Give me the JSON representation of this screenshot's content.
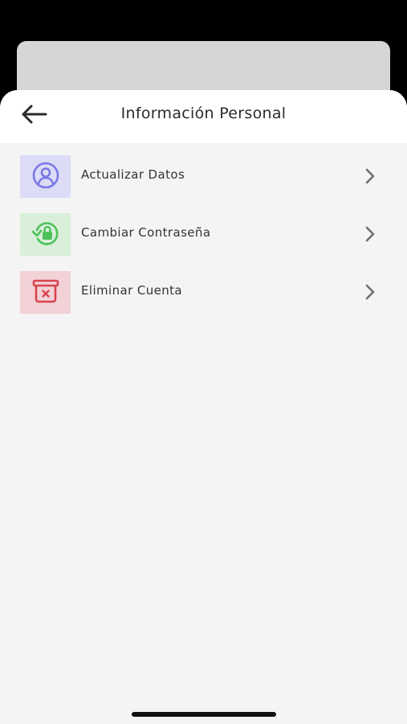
{
  "header": {
    "title": "Información Personal",
    "back_icon": "arrow-left-icon"
  },
  "menu": {
    "items": [
      {
        "label": "Actualizar Datos",
        "icon": "user-circle-icon",
        "tile_color": "#dcdcf6",
        "icon_color": "#7b78e6"
      },
      {
        "label": "Cambiar Contraseña",
        "icon": "lock-reset-icon",
        "tile_color": "#d9efd9",
        "icon_color": "#4cc25a"
      },
      {
        "label": "Eliminar Cuenta",
        "icon": "trash-icon",
        "tile_color": "#f2d2d6",
        "icon_color": "#d9434f"
      }
    ],
    "chevron_icon": "chevron-right-icon"
  },
  "colors": {
    "sheet_background": "#f4f4f4",
    "header_background": "#ffffff",
    "text": "#333333"
  }
}
